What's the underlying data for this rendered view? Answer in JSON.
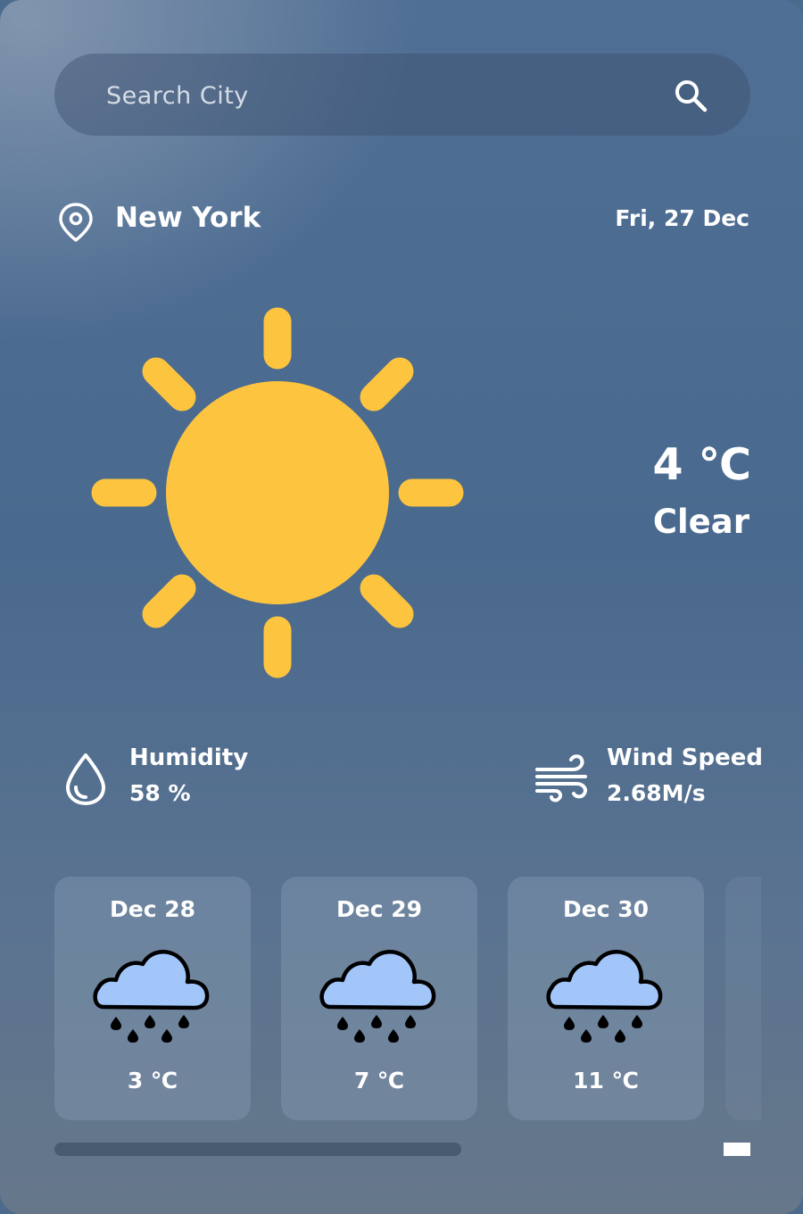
{
  "search": {
    "placeholder": "Search City"
  },
  "location": {
    "city": "New York",
    "date": "Fri, 27 Dec"
  },
  "current": {
    "temperature": "4 ℃",
    "condition": "Clear",
    "icon": "sun-icon"
  },
  "details": {
    "humidity": {
      "label": "Humidity",
      "value": "58 %",
      "icon": "water-drop-icon"
    },
    "wind": {
      "label": "Wind Speed",
      "value": "2.68M/s",
      "icon": "wind-icon"
    }
  },
  "forecast": [
    {
      "date": "Dec 28",
      "temp": "3 ℃",
      "icon": "rain-cloud-icon"
    },
    {
      "date": "Dec 29",
      "temp": "7 ℃",
      "icon": "rain-cloud-icon"
    },
    {
      "date": "Dec 30",
      "temp": "11 ℃",
      "icon": "rain-cloud-icon"
    }
  ],
  "colors": {
    "sun": "#fdc440",
    "cloud": "#a3c6fa",
    "text": "#ffffff"
  }
}
